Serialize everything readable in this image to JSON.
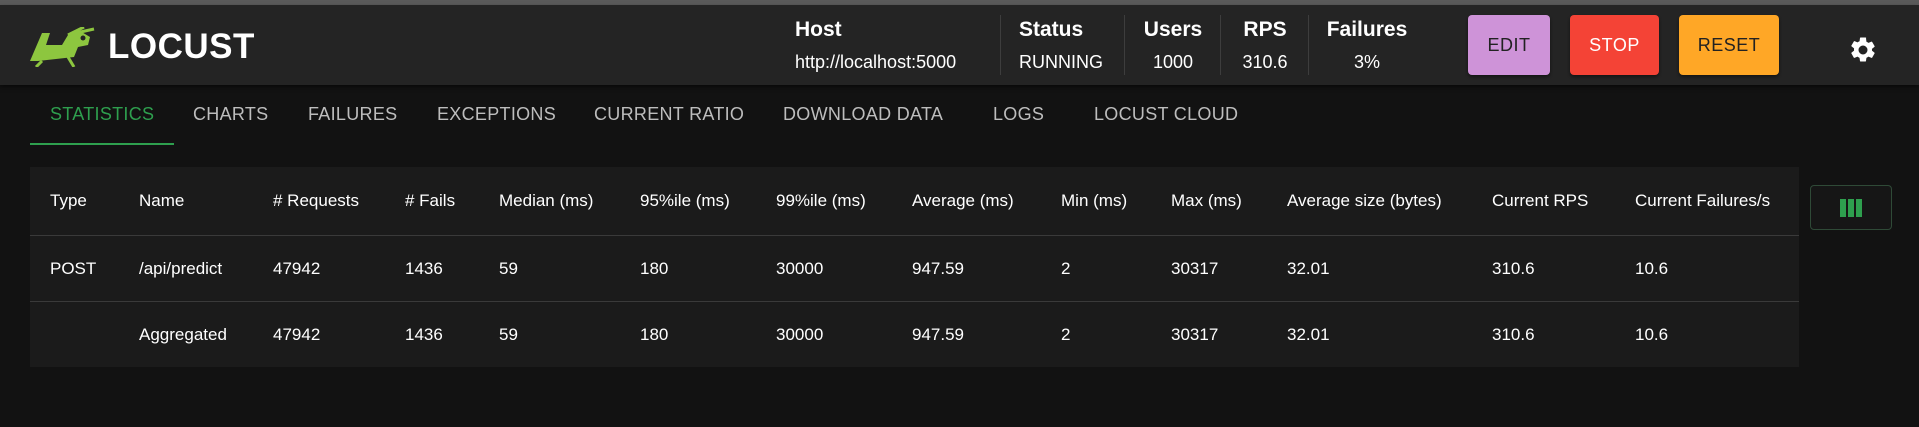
{
  "brand": {
    "name": "LOCUST",
    "logo_icon": "grasshopper-logo-icon",
    "accent": "#8dc63f"
  },
  "header": {
    "host_label": "Host",
    "host_value": "http://localhost:5000",
    "status_label": "Status",
    "status_value": "RUNNING",
    "users_label": "Users",
    "users_value": "1000",
    "rps_label": "RPS",
    "rps_value": "310.6",
    "failures_label": "Failures",
    "failures_value": "3%",
    "edit_label": "EDIT",
    "stop_label": "STOP",
    "reset_label": "RESET",
    "settings_icon": "gear-icon",
    "colors": {
      "edit": "#ce93d8",
      "stop": "#f44336",
      "reset": "#ffa726"
    }
  },
  "tabs": [
    {
      "label": "STATISTICS",
      "active": true
    },
    {
      "label": "CHARTS"
    },
    {
      "label": "FAILURES"
    },
    {
      "label": "EXCEPTIONS"
    },
    {
      "label": "CURRENT RATIO"
    },
    {
      "label": "DOWNLOAD DATA"
    },
    {
      "label": "LOGS"
    },
    {
      "label": "LOCUST CLOUD"
    }
  ],
  "table": {
    "columns": [
      "Type",
      "Name",
      "# Requests",
      "# Fails",
      "Median (ms)",
      "95%ile (ms)",
      "99%ile (ms)",
      "Average (ms)",
      "Min (ms)",
      "Max (ms)",
      "Average size (bytes)",
      "Current RPS",
      "Current Failures/s"
    ],
    "rows": [
      [
        "POST",
        "/api/predict",
        "47942",
        "1436",
        "59",
        "180",
        "30000",
        "947.59",
        "2",
        "30317",
        "32.01",
        "310.6",
        "10.6"
      ],
      [
        "",
        "Aggregated",
        "47942",
        "1436",
        "59",
        "180",
        "30000",
        "947.59",
        "2",
        "30317",
        "32.01",
        "310.6",
        "10.6"
      ]
    ],
    "column_selector_icon": "columns-icon"
  }
}
